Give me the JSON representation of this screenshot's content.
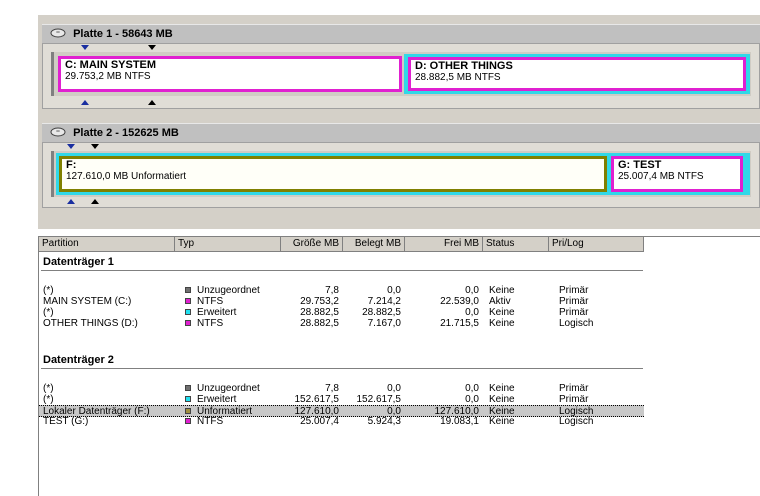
{
  "disks": [
    {
      "title": "Platte 1 - 58643 MB",
      "partitions": [
        {
          "name": "C:  MAIN SYSTEM",
          "info": "29.753,2 MB   NTFS",
          "color": "#e020d0"
        },
        {
          "name": "D:  OTHER THINGS",
          "info": "28.882,5 MB   NTFS",
          "color": "#e020d0"
        }
      ]
    },
    {
      "title": "Platte 2 - 152625 MB",
      "partitions": [
        {
          "name": "F:",
          "info": "127.610,0 MB    Unformatiert",
          "color": "#808000"
        },
        {
          "name": "G:  TEST",
          "info": "25.007,4 MB    NTFS",
          "color": "#e020d0"
        }
      ]
    }
  ],
  "table": {
    "headers": [
      "Partition",
      "Typ",
      "Größe MB",
      "Belegt MB",
      "Frei MB",
      "Status",
      "Pri/Log"
    ],
    "groups": [
      {
        "title": "Datenträger 1",
        "rows": [
          {
            "partition": "(*)",
            "type": "Unzugeordnet",
            "type_color": "#707070",
            "size": "7,8",
            "used": "0,0",
            "free": "0,0",
            "status": "Keine",
            "prilog": "Primär"
          },
          {
            "partition": "MAIN SYSTEM (C:)",
            "type": "NTFS",
            "type_color": "#e020d0",
            "size": "29.753,2",
            "used": "7.214,2",
            "free": "22.539,0",
            "status": "Aktiv",
            "prilog": "Primär"
          },
          {
            "partition": "(*)",
            "type": "Erweitert",
            "type_color": "#20e0f0",
            "size": "28.882,5",
            "used": "28.882,5",
            "free": "0,0",
            "status": "Keine",
            "prilog": "Primär"
          },
          {
            "partition": "OTHER THINGS (D:)",
            "type": "NTFS",
            "type_color": "#e020d0",
            "size": "28.882,5",
            "used": "7.167,0",
            "free": "21.715,5",
            "status": "Keine",
            "prilog": "Logisch"
          }
        ]
      },
      {
        "title": "Datenträger 2",
        "rows": [
          {
            "partition": "(*)",
            "type": "Unzugeordnet",
            "type_color": "#707070",
            "size": "7,8",
            "used": "0,0",
            "free": "0,0",
            "status": "Keine",
            "prilog": "Primär"
          },
          {
            "partition": "(*)",
            "type": "Erweitert",
            "type_color": "#20e0f0",
            "size": "152.617,5",
            "used": "152.617,5",
            "free": "0,0",
            "status": "Keine",
            "prilog": "Primär"
          },
          {
            "partition": "Lokaler Datenträger (F:)",
            "type": "Unformatiert",
            "type_color": "#a09040",
            "size": "127.610,0",
            "used": "0,0",
            "free": "127.610,0",
            "status": "Keine",
            "prilog": "Logisch",
            "selected": true
          },
          {
            "partition": "TEST (G:)",
            "type": "NTFS",
            "type_color": "#e020d0",
            "size": "25.007,4",
            "used": "5.924,3",
            "free": "19.083,1",
            "status": "Keine",
            "prilog": "Logisch"
          }
        ]
      }
    ]
  }
}
